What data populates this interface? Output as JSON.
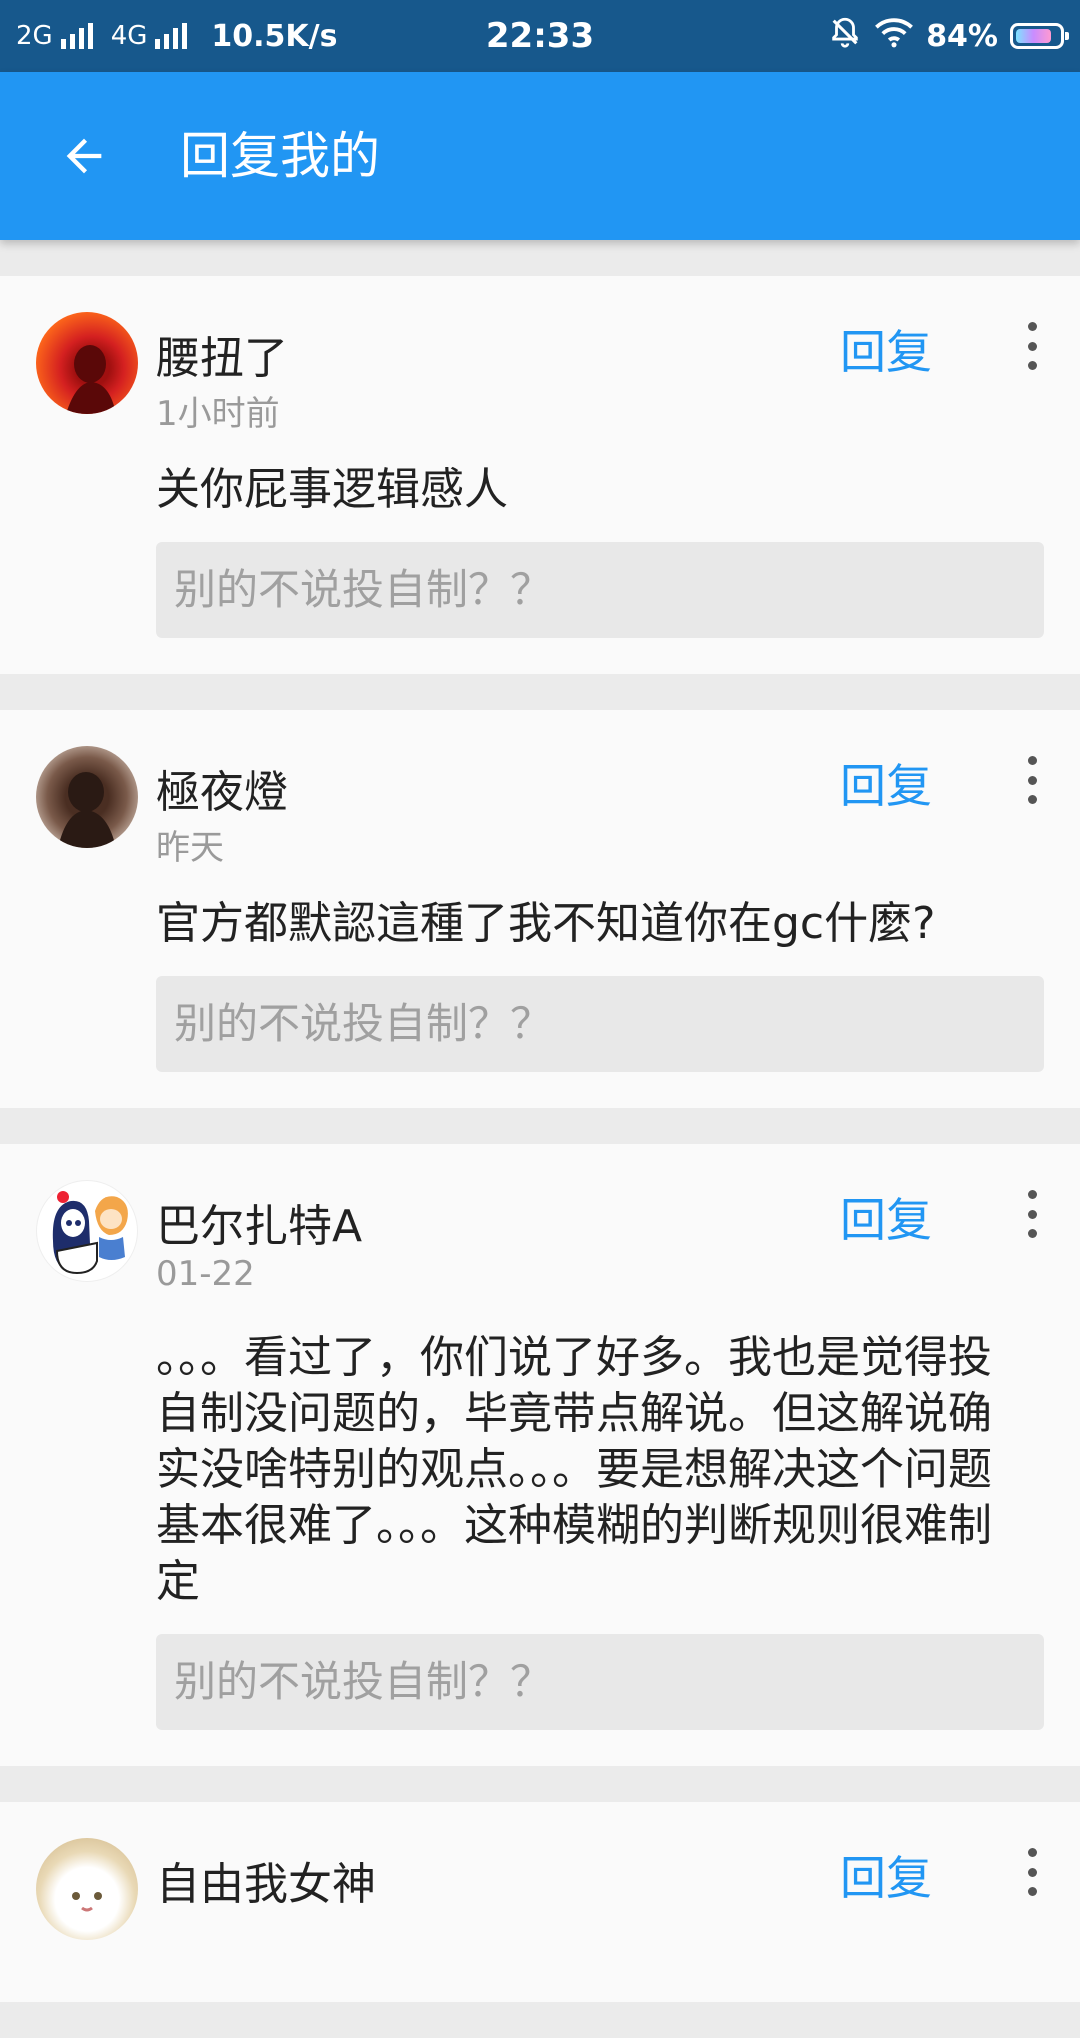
{
  "status_bar": {
    "net1": "2G",
    "net2": "4G",
    "speed": "10.5K/s",
    "time": "22:33",
    "battery": "84%",
    "battery_level": 0.84
  },
  "app_bar": {
    "title": "回复我的"
  },
  "items": [
    {
      "name": "腰扭了",
      "time": "1小时前",
      "reply_label": "回复",
      "comment": "关你屁事逻辑感人",
      "quote": "别的不说投自制？？"
    },
    {
      "name": "極夜燈",
      "time": "昨天",
      "reply_label": "回复",
      "comment": "官方都默認這種了我不知道你在gc什麼?",
      "quote": "别的不说投自制？？"
    },
    {
      "name": "巴尔扎特A",
      "time": "01-22",
      "reply_label": "回复",
      "comment": "。。。看过了，你们说了好多。我也是觉得投自制没问题的，毕竟带点解说。但这解说确实没啥特别的观点。。。要是想解决这个问题基本很难了。。。这种模糊的判断规则很难制定",
      "quote": "别的不说投自制？？"
    },
    {
      "name": "自由我女神",
      "reply_label": "回复"
    }
  ]
}
